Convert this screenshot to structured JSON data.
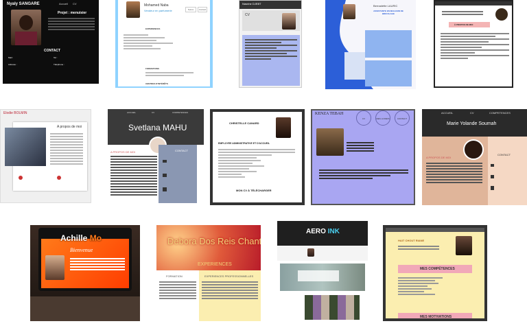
{
  "tiles": [
    {
      "name": "Nyaly SANGARE",
      "nav": [
        "Accueil",
        "CV"
      ],
      "heading": "Projet : menuisier",
      "section": "CONTACT",
      "labels": [
        "Mail :",
        "Adresse :",
        "Tel :",
        "Téléphone :"
      ]
    },
    {
      "name": "Mohamed Naba",
      "subtitle": "Vendeur en parfumerie",
      "buttons": [
        "Suivre",
        "Contact"
      ],
      "sections": [
        "EXPERIENCES",
        "FORMATIONS",
        "CENTRES D'INTÉRÊTS"
      ]
    },
    {
      "name": "Nasrine DJEBT",
      "heading": "CV"
    },
    {
      "name": "Bernadette LAURIC",
      "subtitle": "ASSISTANTE EN MAGASIN DE BRICOLAGE"
    },
    {
      "heading": "À PROPOS DE MOI"
    },
    {
      "name": "Elodie BOLMIN",
      "heading": "A propos de moi"
    },
    {
      "name": "Svetlana MAHU",
      "nav": [
        "ACCUEIL",
        "CV",
        "COMPETENCES"
      ],
      "section1": "A PROPOS DE MOI",
      "section2": "CONTACT"
    },
    {
      "name": "CHRISTELLE CANARD",
      "heading": "EMPLOYEE ADMINISTRATIVE ET D'ACCUEIL",
      "section": "MON CV À TÉLÉCHARGER"
    },
    {
      "name": "KENZA TEBAH",
      "circles": [
        "CV",
        "MES LOISIRS",
        "CONTACT"
      ]
    },
    {
      "name": "Marie Yolande Soumah",
      "nav": [
        "ACCUEIL",
        "CV",
        "COMPETENCES"
      ],
      "section1": "A PROPOS DE MOI",
      "section2": "CONTACT"
    },
    {
      "name": "Achille",
      "name_accent": "Mo",
      "greeting": "Bienvenue"
    },
    {
      "name": "Debora Dos Reis Chantre",
      "subtitle": "EXPERIENCES",
      "col1": "FORMATION",
      "col2": "EXPERIENCES PROFESSIONNELLES"
    },
    {
      "name_a": "AERO",
      "name_b": "INK"
    },
    {
      "name": "HAIT CHOUT RIANE",
      "sections": [
        "MES COMPÉTENCES",
        "MES MOTIVATIONS"
      ]
    }
  ],
  "colors": {
    "dark": "#111111",
    "blue": "#8fd3ff",
    "lavender": "#a9a6f2",
    "peach": "#e0b59a",
    "yellow": "#fbeeb0",
    "pink": "#f1a8b8"
  }
}
